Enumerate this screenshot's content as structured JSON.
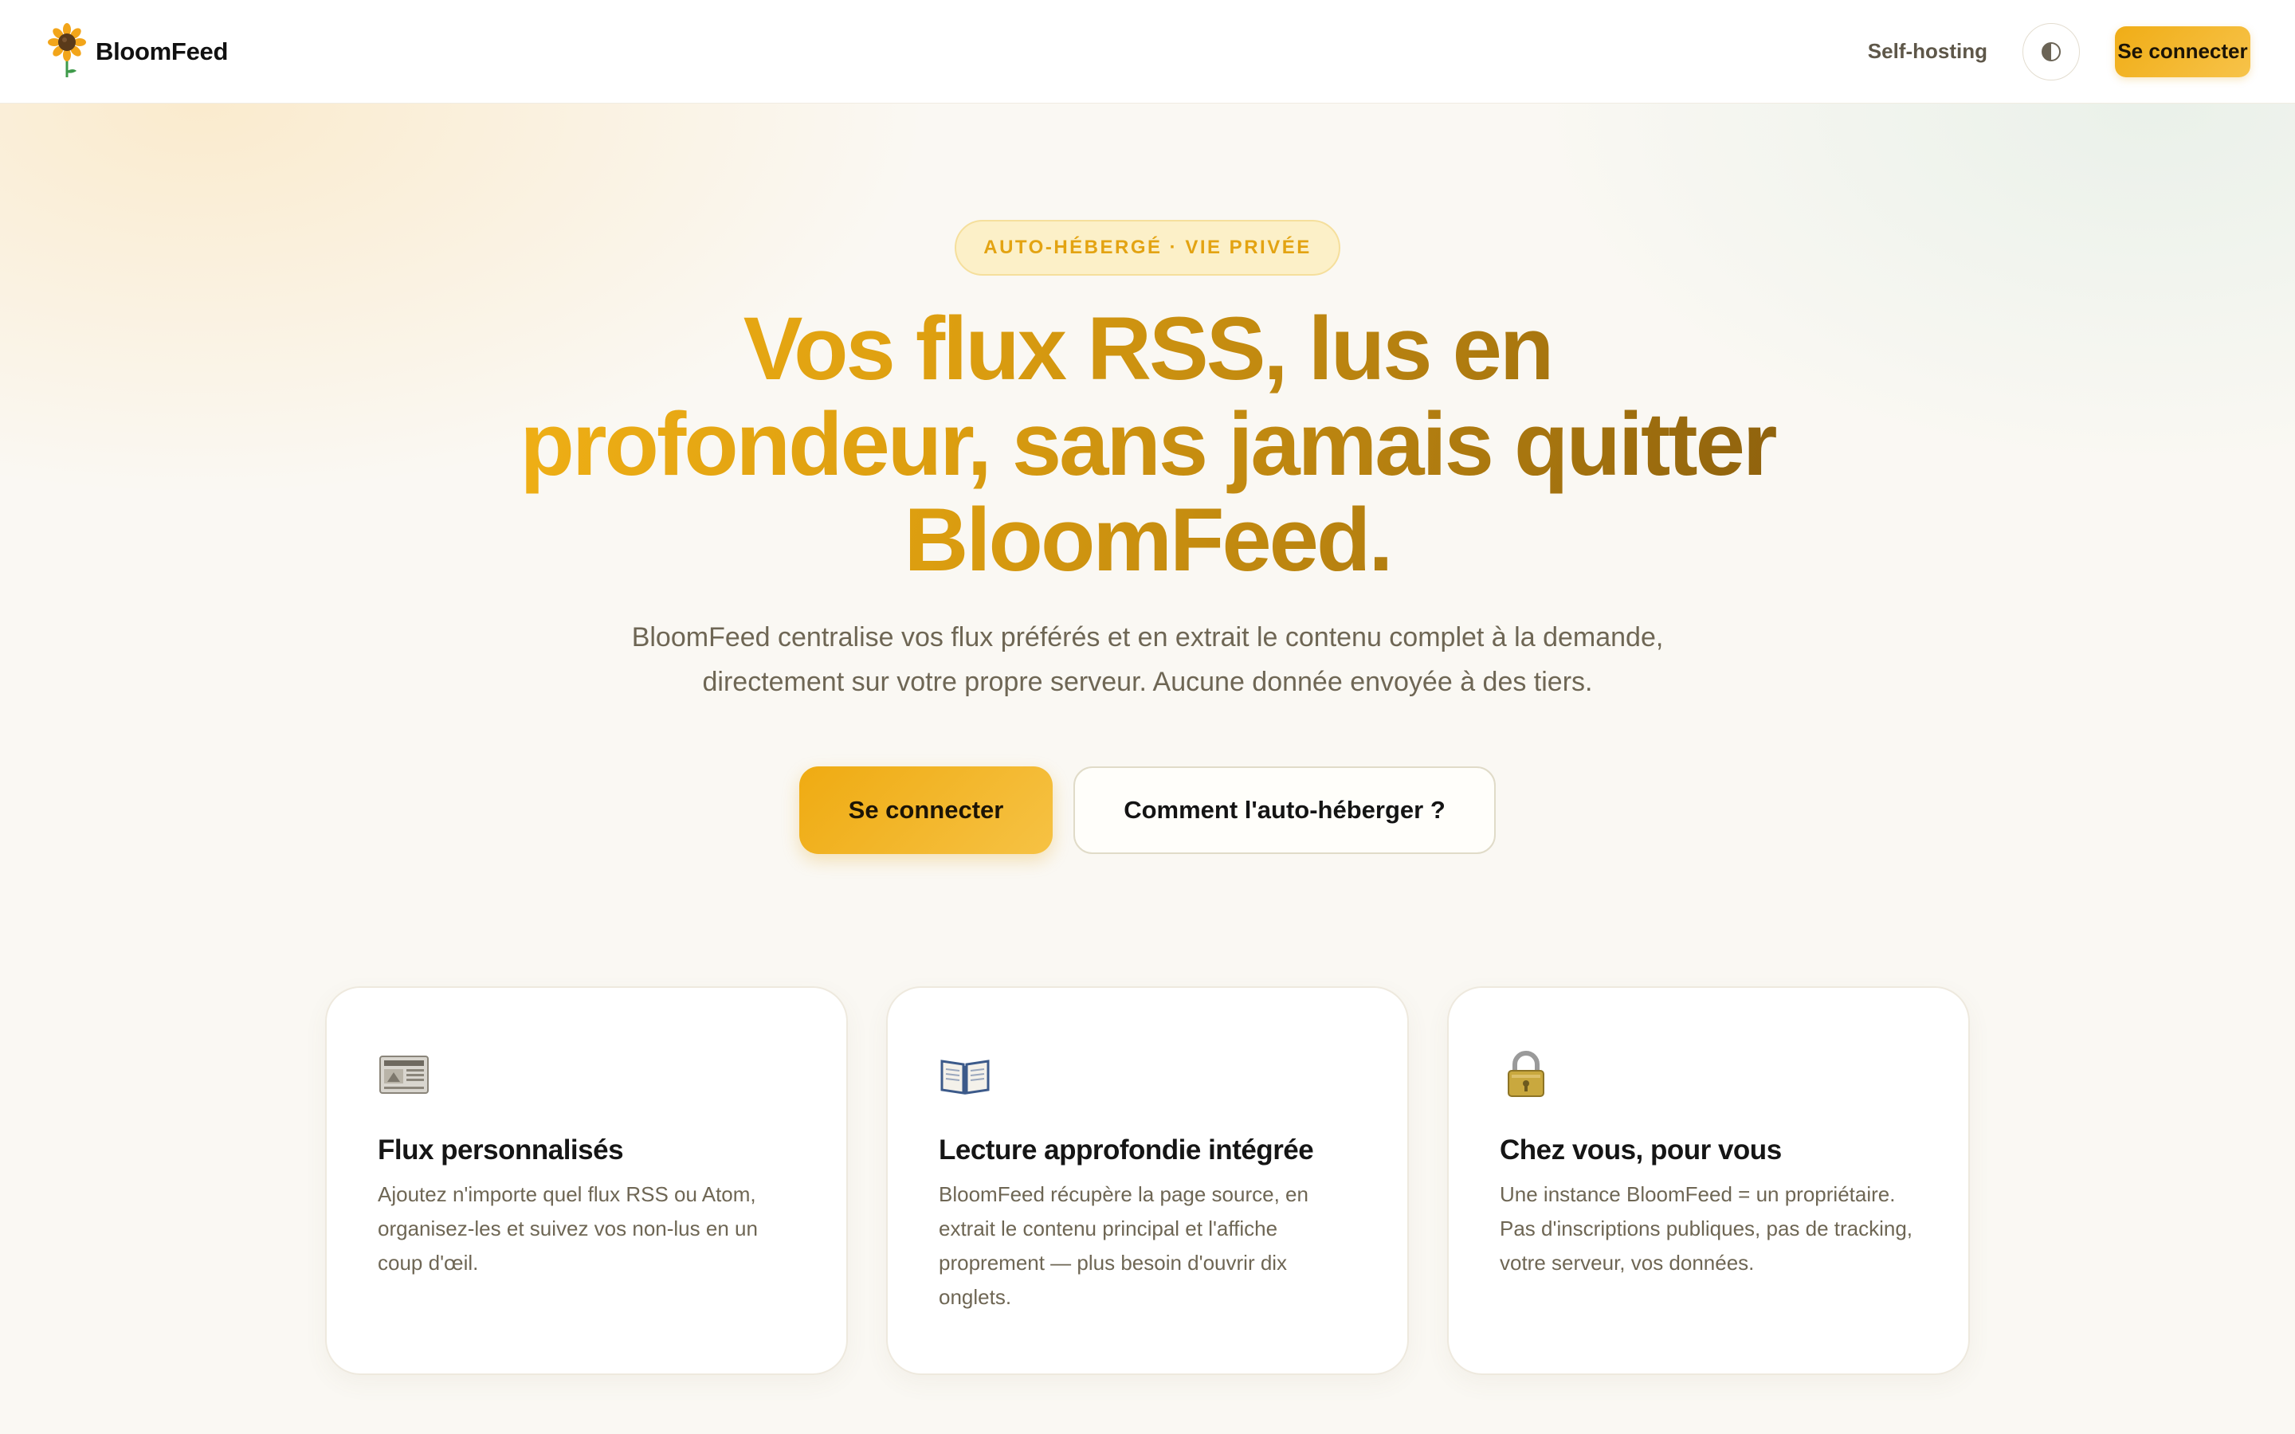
{
  "header": {
    "brand_name": "BloomFeed",
    "nav_link": "Self-hosting",
    "theme_toggle_icon": "half-circle-contrast-icon",
    "cta_label": "Se connecter"
  },
  "hero": {
    "badge": "AUTO-HÉBERGÉ · VIE PRIVÉE",
    "title": "Vos flux RSS, lus en profondeur, sans jamais quitter BloomFeed.",
    "subtitle": "BloomFeed centralise vos flux préférés et en extrait le contenu complet à la demande, directement sur votre propre serveur. Aucune donnée envoyée à des tiers.",
    "primary_cta": "Se connecter",
    "secondary_cta": "Comment l'auto-héberger ?"
  },
  "features": [
    {
      "icon": "newspaper-icon",
      "title": "Flux personnalisés",
      "text": "Ajoutez n'importe quel flux RSS ou Atom, organisez-les et suivez vos non-lus en un coup d'œil."
    },
    {
      "icon": "open-book-icon",
      "title": "Lecture approfondie intégrée",
      "text": "BloomFeed récupère la page source, en extrait le contenu principal et l'affiche proprement — plus besoin d'ouvrir dix onglets."
    },
    {
      "icon": "lock-icon",
      "title": "Chez vous, pour vous",
      "text": "Une instance BloomFeed = un propriétaire. Pas d'inscriptions publiques, pas de tracking, votre serveur, vos données."
    }
  ],
  "colors": {
    "accent": "#F0AD16",
    "accent_dark": "#8C600D",
    "badge_bg": "#FCF0C8",
    "text_muted": "#6E6654",
    "background": "#FAF8F3"
  }
}
